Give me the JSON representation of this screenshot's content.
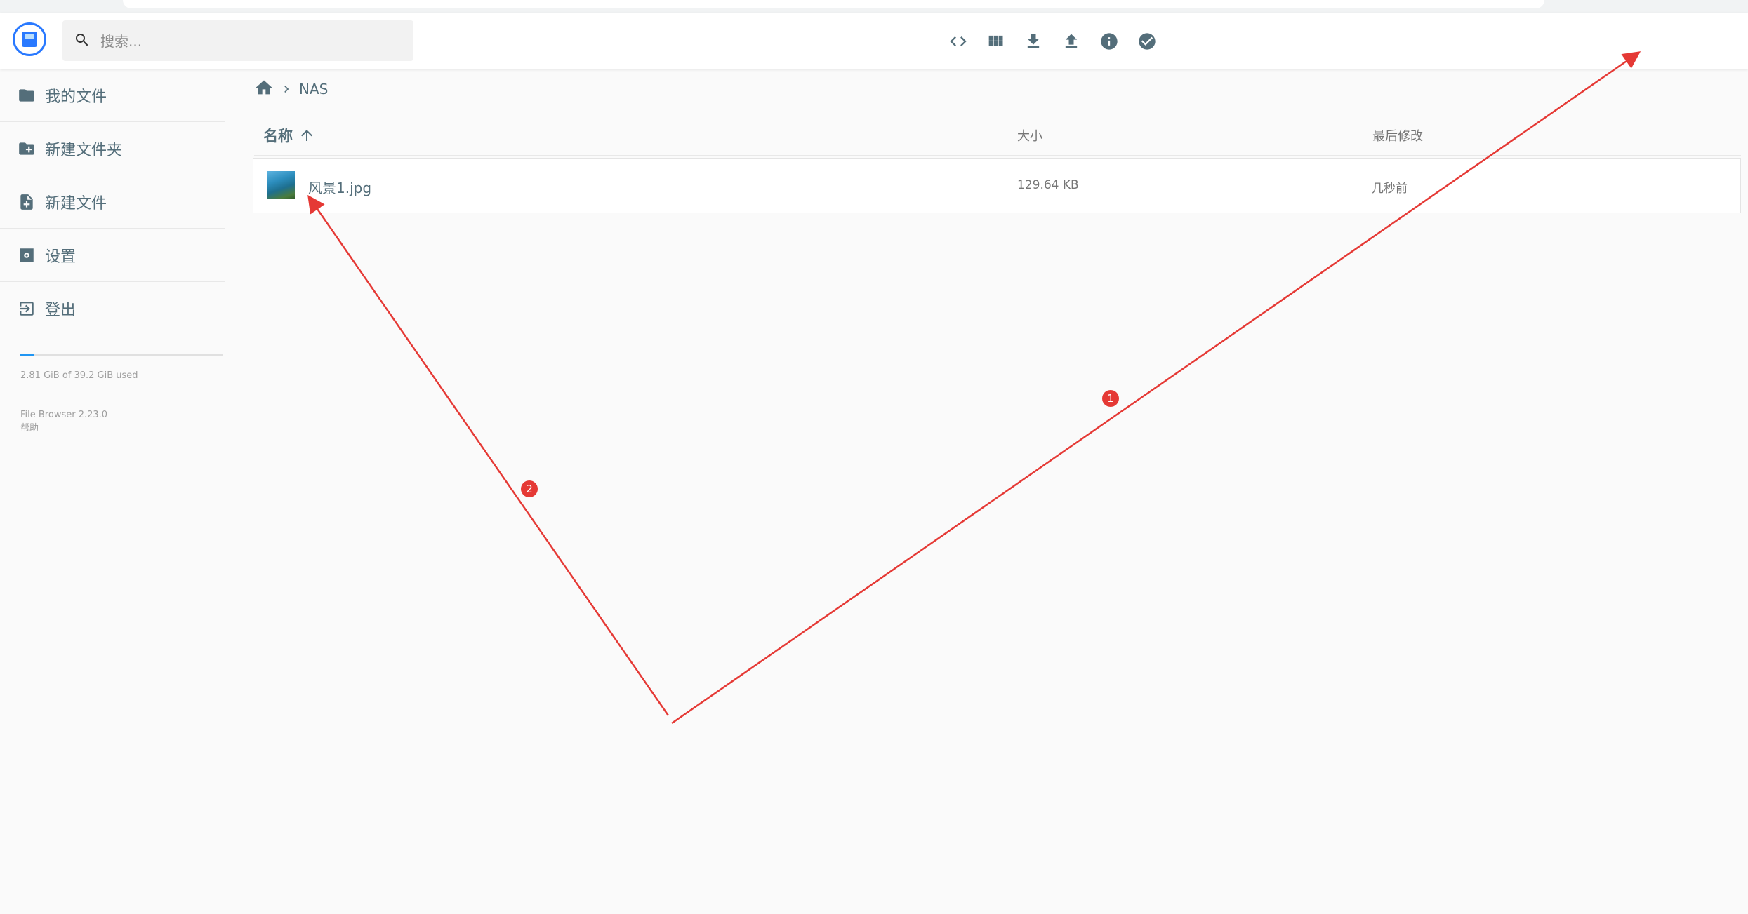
{
  "search": {
    "placeholder": "搜索..."
  },
  "header": {
    "actions": [
      "code-icon",
      "grid-view-icon",
      "download-icon",
      "upload-icon",
      "info-icon",
      "check-circle-icon"
    ]
  },
  "sidebar": {
    "items": [
      {
        "label": "我的文件",
        "icon": "folder-icon"
      },
      {
        "label": "新建文件夹",
        "icon": "create-folder-icon"
      },
      {
        "label": "新建文件",
        "icon": "new-file-icon"
      },
      {
        "label": "设置",
        "icon": "settings-icon"
      },
      {
        "label": "登出",
        "icon": "logout-icon"
      }
    ],
    "usage": {
      "text": "2.81 GiB of 39.2 GiB used",
      "fraction": 0.07
    },
    "credits": {
      "app": "File Browser 2.23.0",
      "help": "帮助"
    }
  },
  "breadcrumb": {
    "current": "NAS"
  },
  "listing": {
    "columns": {
      "name": "名称",
      "size": "大小",
      "modified": "最后修改"
    },
    "rows": [
      {
        "name": "风景1.jpg",
        "size": "129.64 KB",
        "modified": "几秒前"
      }
    ]
  },
  "annotations": [
    {
      "label": "1",
      "color": "#e53935"
    },
    {
      "label": "2",
      "color": "#e53935"
    }
  ]
}
